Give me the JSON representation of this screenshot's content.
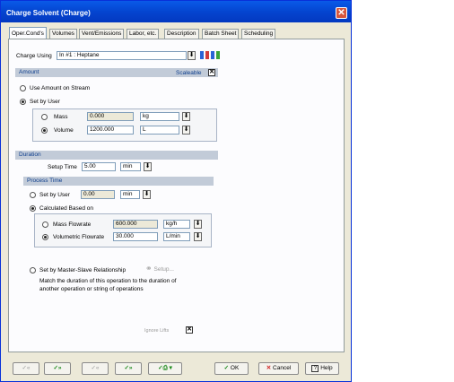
{
  "window": {
    "title": "Charge Solvent (Charge)"
  },
  "tabs": [
    {
      "label": "Oper.Cond's"
    },
    {
      "label": "Volumes"
    },
    {
      "label": "Vent/Emissions"
    },
    {
      "label": "Labor, etc."
    },
    {
      "label": "Description"
    },
    {
      "label": "Batch Sheet"
    },
    {
      "label": "Scheduling"
    }
  ],
  "charge": {
    "label": "Charge Using",
    "value": "In #1 : Heptane"
  },
  "amount": {
    "header": "Amount",
    "scaleable_label": "Scaleable",
    "scaleable_checked": true,
    "use_stream_label": "Use Amount on Stream",
    "set_by_user_label": "Set by User",
    "mass": {
      "label": "Mass",
      "value": "0.000",
      "unit": "kg"
    },
    "volume": {
      "label": "Volume",
      "value": "1200.000",
      "unit": "L"
    }
  },
  "duration": {
    "header": "Duration",
    "setup_time_label": "Setup Time",
    "setup_time_value": "5.00",
    "setup_time_unit": "min",
    "process_time": {
      "header": "Process Time",
      "set_by_user_label": "Set by User",
      "set_by_user_value": "0.00",
      "set_by_user_unit": "min",
      "calculated_label": "Calculated Based on",
      "mass_flowrate": {
        "label": "Mass Flowrate",
        "value": "600.000",
        "unit": "kg/h"
      },
      "vol_flowrate": {
        "label": "Volumetric Flowrate",
        "value": "30.000",
        "unit": "L/min"
      },
      "master_slave_label": "Set by Master-Slave Relationship",
      "setup_label": "Setup...",
      "master_slave_desc_1": "Match the duration of this operation to the duration of",
      "master_slave_desc_2": "another operation or string of operations",
      "ignore_label": "Ignore Lifts",
      "ignore_checked": true
    }
  },
  "footer": {
    "ok_label": "OK",
    "cancel_label": "Cancel",
    "help_label": "Help"
  }
}
